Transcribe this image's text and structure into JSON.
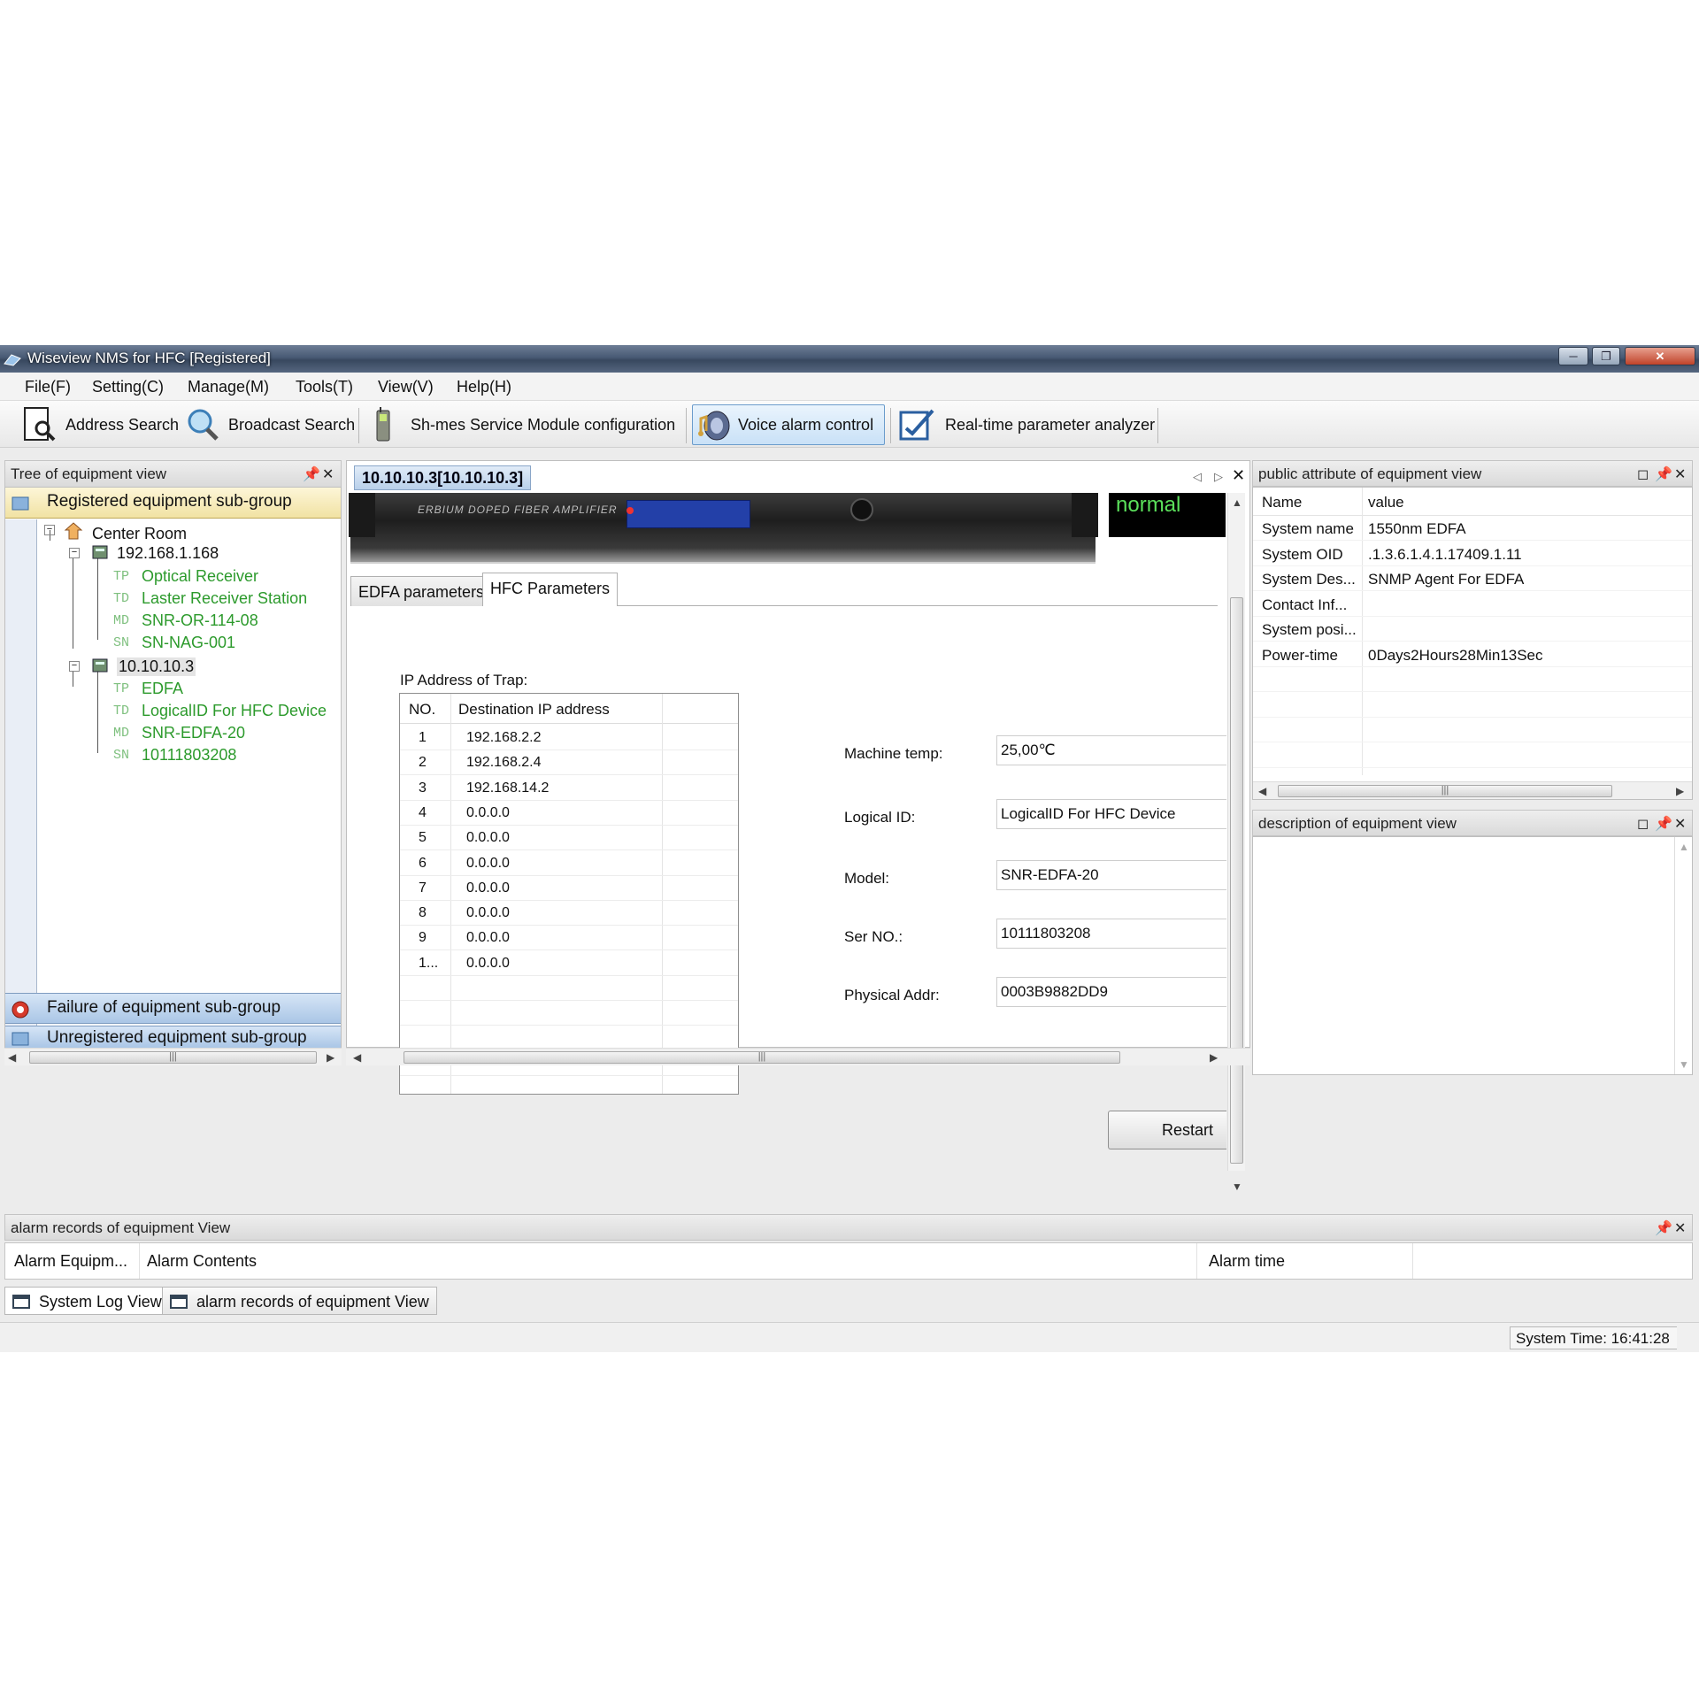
{
  "window": {
    "title": "Wiseview NMS for HFC  [Registered]"
  },
  "menu": [
    "File(F)",
    "Setting(C)",
    "Manage(M)",
    "Tools(T)",
    "View(V)",
    "Help(H)"
  ],
  "toolbar": {
    "address_search": "Address Search",
    "broadcast_search": "Broadcast Search",
    "service_module": "Sh-mes Service Module configuration",
    "voice_alarm": "Voice alarm control",
    "realtime_analyzer": "Real-time parameter analyzer"
  },
  "left": {
    "title": "Tree of equipment view",
    "registered": "Registered equipment sub-group",
    "failure": "Failure of equipment sub-group",
    "unregistered": "Unregistered equipment sub-group",
    "tree": {
      "root": "Center Room",
      "host1": "192.168.1.168",
      "host1_items": [
        "Optical Receiver",
        "Laster Receiver Station",
        "SNR-OR-114-08",
        "SN-NAG-001"
      ],
      "host2": "10.10.10.3",
      "host2_items": [
        "EDFA",
        "LogicalID For HFC Device",
        "SNR-EDFA-20",
        "10111803208"
      ],
      "prefixes": [
        "TP",
        "TD",
        "MD",
        "SN"
      ]
    }
  },
  "center": {
    "doc_tab": "10.10.10.3[10.10.10.3]",
    "device_label": "ERBIUM DOPED FIBER AMPLIFIER",
    "status": "normal",
    "tabs": [
      "EDFA parameters",
      "HFC Parameters"
    ],
    "trap": {
      "label": "IP Address of Trap:",
      "col_no": "NO.",
      "col_ip": "Destination IP address",
      "rows": [
        {
          "no": "1",
          "ip": "192.168.2.2"
        },
        {
          "no": "2",
          "ip": "192.168.2.4"
        },
        {
          "no": "3",
          "ip": "192.168.14.2"
        },
        {
          "no": "4",
          "ip": "0.0.0.0"
        },
        {
          "no": "5",
          "ip": "0.0.0.0"
        },
        {
          "no": "6",
          "ip": "0.0.0.0"
        },
        {
          "no": "7",
          "ip": "0.0.0.0"
        },
        {
          "no": "8",
          "ip": "0.0.0.0"
        },
        {
          "no": "9",
          "ip": "0.0.0.0"
        },
        {
          "no": "1...",
          "ip": "0.0.0.0"
        }
      ]
    },
    "fields": {
      "machine_temp_label": "Machine temp:",
      "machine_temp": "25,00℃",
      "logical_id_label": "Logical ID:",
      "logical_id": "LogicalID For HFC Device",
      "model_label": "Model:",
      "model": "SNR-EDFA-20",
      "ser_no_label": "Ser NO.:",
      "ser_no": "10111803208",
      "phys_label": "Physical Addr:",
      "phys": "0003B9882DD9"
    },
    "restart": "Restart"
  },
  "attributes": {
    "title": "public attribute of equipment view",
    "col_name": "Name",
    "col_value": "value",
    "rows": [
      {
        "k": "System name",
        "v": "1550nm EDFA"
      },
      {
        "k": "System OID",
        "v": ".1.3.6.1.4.1.17409.1.11"
      },
      {
        "k": "System Des...",
        "v": "SNMP Agent For EDFA"
      },
      {
        "k": "Contact Inf...",
        "v": ""
      },
      {
        "k": "System posi...",
        "v": ""
      },
      {
        "k": "Power-time",
        "v": "0Days2Hours28Min13Sec"
      }
    ]
  },
  "description": {
    "title": "description of equipment view"
  },
  "alarm": {
    "title": "alarm records of equipment View",
    "col_equipment": "Alarm Equipm...",
    "col_contents": "Alarm Contents",
    "col_time": "Alarm time"
  },
  "bottom_tabs": [
    "System Log View",
    "alarm records of equipment View"
  ],
  "status": {
    "system_time": "System Time: 16:41:28"
  }
}
